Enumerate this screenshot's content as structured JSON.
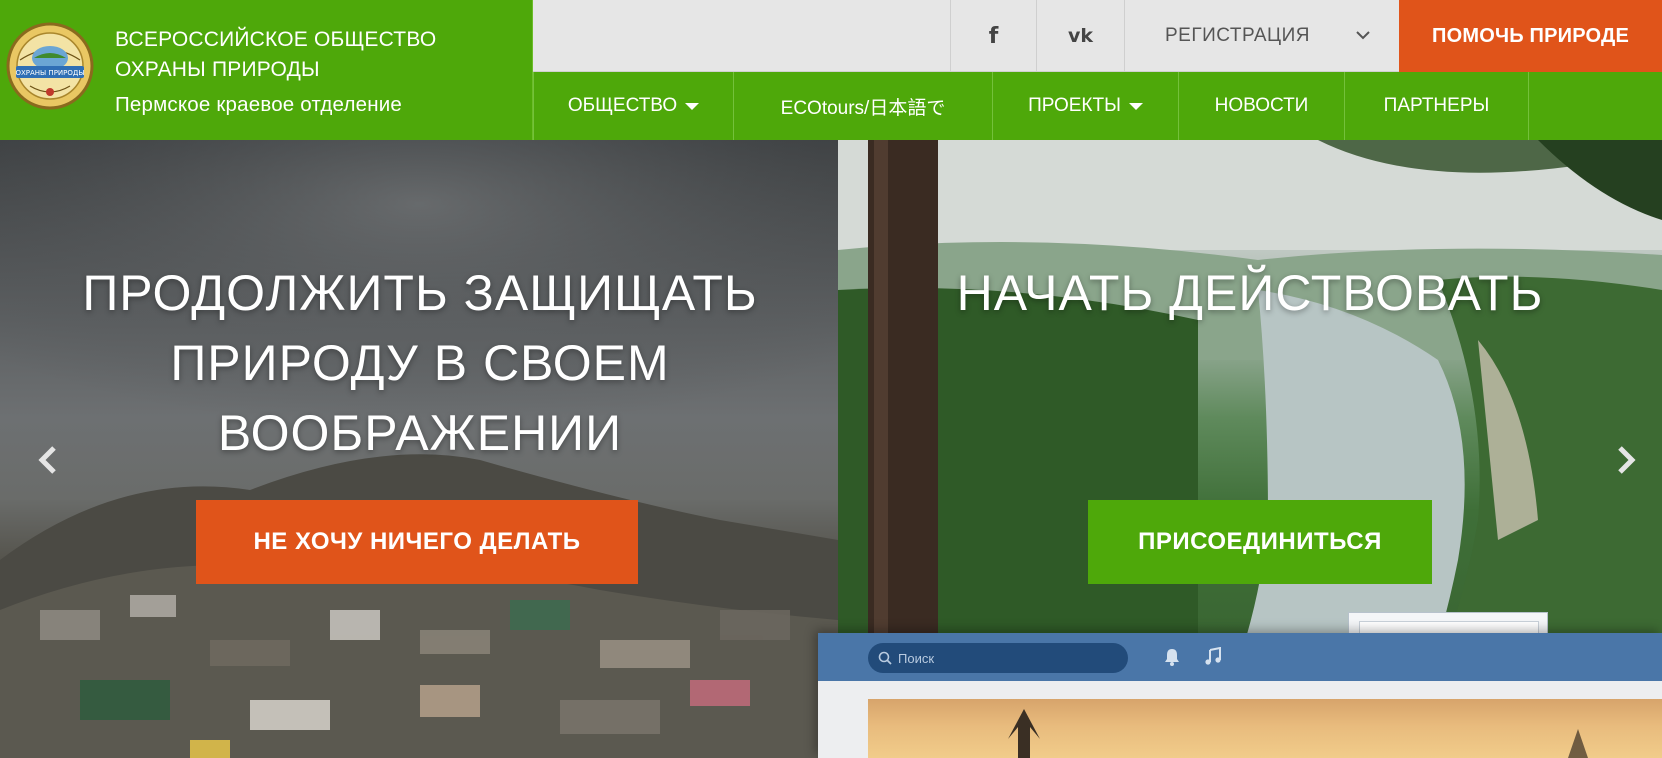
{
  "brand": {
    "line1": "ВСЕРОССИЙСКОЕ ОБЩЕСТВО",
    "line2": "ОХРАНЫ ПРИРОДЫ",
    "line3": "Пермское краевое отделение",
    "logo_icon": "vop-emblem-logo",
    "logo_ribbon_text": "ОХРАНЫ ПРИРОДЫ"
  },
  "topbar": {
    "facebook_glyph": "f",
    "vk_glyph": "vk",
    "register_label": "РЕГИСТРАЦИЯ",
    "help_label": "ПОМОЧЬ ПРИРОДЕ"
  },
  "nav": {
    "items": [
      {
        "label": "ОБЩЕСТВО",
        "has_dropdown": true
      },
      {
        "label": "ECOtours/日本語で",
        "has_dropdown": false
      },
      {
        "label": "ПРОЕКТЫ",
        "has_dropdown": true
      },
      {
        "label": "НОВОСТИ",
        "has_dropdown": false
      },
      {
        "label": "ПАРТНЕРЫ",
        "has_dropdown": false
      }
    ]
  },
  "hero": {
    "left_title": "ПРОДОЛЖИТЬ ЗАЩИЩАТЬ ПРИРОДУ В СВОЕМ ВООБРАЖЕНИИ",
    "left_button": "НЕ ХОЧУ НИЧЕГО ДЕЛАТЬ",
    "right_title": "НАЧАТЬ ДЕЙСТВОВАТЬ",
    "right_button": "ПРИСОЕДИНИТЬСЯ"
  },
  "vk_window": {
    "search_placeholder": "Поиск"
  },
  "colors": {
    "brand_green": "#4ea80a",
    "accent_orange": "#e0541a",
    "vk_blue": "#4a76a8"
  }
}
